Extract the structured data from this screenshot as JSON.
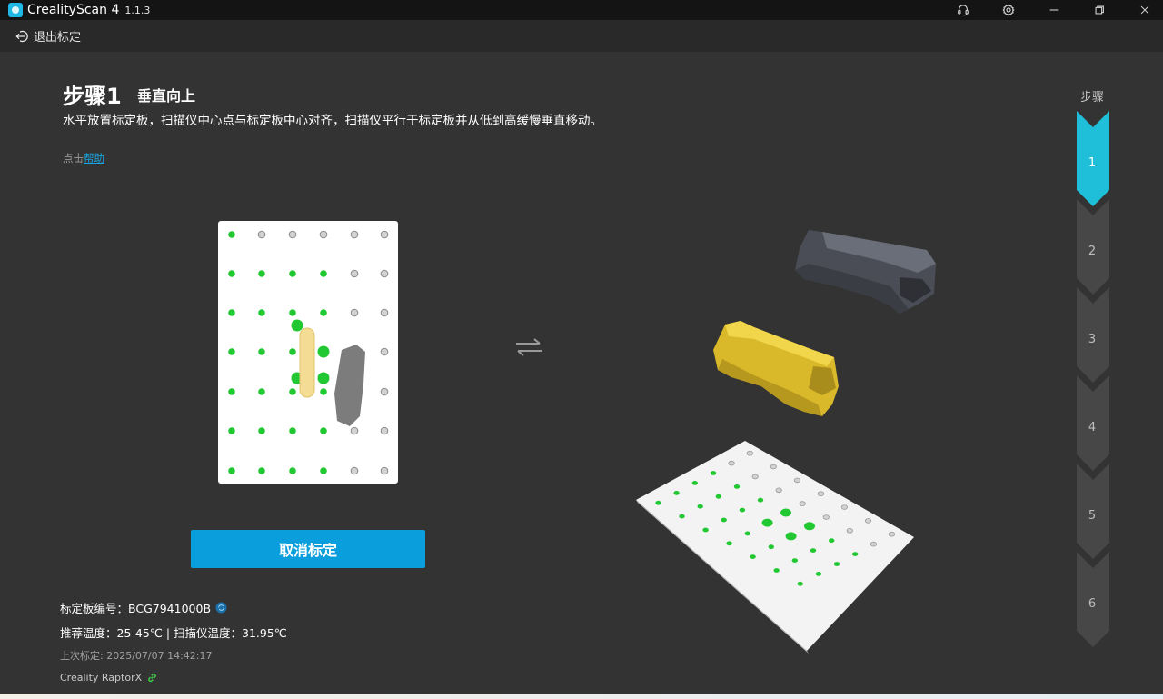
{
  "app": {
    "name": "CrealityScan 4",
    "version": "1.1.3"
  },
  "header": {
    "exit_label": "退出标定"
  },
  "step": {
    "title": "步骤1",
    "subtitle": "垂直向上",
    "instruction": "水平放置标定板，扫描仪中心点与标定板中心对齐，扫描仪平行于标定板并从低到高缓慢垂直移动。",
    "help_prefix": "点击",
    "help_link": "帮助"
  },
  "cancel_button": "取消标定",
  "info": {
    "board_id": "标定板编号：BCG7941000B",
    "temperature": "推荐温度：25-45℃ | 扫描仪温度：31.95℃",
    "last_calibration": "上次标定: 2025/07/07 14:42:17",
    "device": "Creality RaptorX"
  },
  "steps": {
    "label": "步骤",
    "items": [
      "1",
      "2",
      "3",
      "4",
      "5",
      "6"
    ],
    "active": 1
  },
  "colors": {
    "accent": "#0a9fdc",
    "step_active": "#1fbfd9",
    "marker_green": "#22c832",
    "scanner_yellow": "#e6c832"
  },
  "icons": {
    "titlebar": [
      "headset-icon",
      "gear-icon",
      "minimize-icon",
      "restore-icon",
      "close-icon"
    ],
    "exit": "exit-arrow-icon",
    "swap": "swap-arrows-icon",
    "refresh": "refresh-icon",
    "link": "link-icon"
  }
}
